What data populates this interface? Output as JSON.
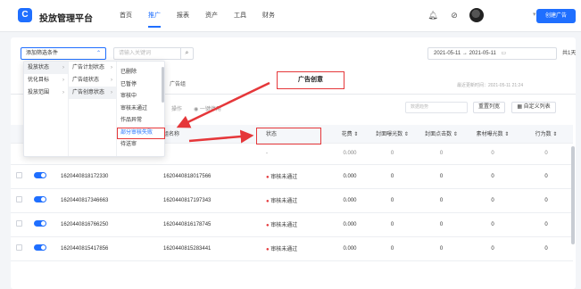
{
  "app": {
    "logo_text": "C",
    "title": "投放管理平台"
  },
  "nav": [
    "首页",
    "推广",
    "报表",
    "资产",
    "工具",
    "财务"
  ],
  "header": {
    "user_caret": "▾",
    "create_button": "创建广告"
  },
  "filters": {
    "add_filter": "添加筛选条件",
    "search_placeholder": "请输入关键词",
    "date_range": "2021-05-11  →  2021-05-11",
    "days": "共1天"
  },
  "dropdown": {
    "col1": [
      "投放状态",
      "优化目标",
      "投放范围"
    ],
    "col2": [
      "广告计划状态",
      "广告组状态",
      "广告创意状态"
    ],
    "col3": [
      "已删除",
      "已暂停",
      "审核中",
      "审核未通过",
      "作品异常",
      "部分审核失败",
      "待送审"
    ]
  },
  "tabs": {
    "adgroup": "广告组",
    "creative": "广告创意"
  },
  "update_time": "最近更新时间：2021-05-11 21:24",
  "toolbar": {
    "batch_select": "操作",
    "batch_label": "◉ 一键停用",
    "data_select": "数据趋势",
    "reset_button": "重置列宽",
    "custom_button": "▦ 自定义列表"
  },
  "table": {
    "headers": [
      "",
      "",
      "",
      "组名称",
      "状态",
      "花费 ⇕",
      "封面曝光数 ⇕",
      "封面点击数 ⇕",
      "素材曝光数 ⇕",
      "行为数 ⇕"
    ],
    "summary": {
      "name": "-",
      "status": "-",
      "spend": "0.000",
      "c1": "0",
      "c2": "0",
      "c3": "0",
      "c4": "0"
    },
    "rows": [
      {
        "id": "1620440818172330",
        "group": "1620440818017566",
        "status": "审核未通过",
        "spend": "0.000",
        "c1": "0",
        "c2": "0",
        "c3": "0",
        "c4": "0"
      },
      {
        "id": "1620440817346663",
        "group": "1620440817197343",
        "status": "审核未通过",
        "spend": "0.000",
        "c1": "0",
        "c2": "0",
        "c3": "0",
        "c4": "0"
      },
      {
        "id": "1620440816766250",
        "group": "1620440816178745",
        "status": "审核未通过",
        "spend": "0.000",
        "c1": "0",
        "c2": "0",
        "c3": "0",
        "c4": "0"
      },
      {
        "id": "1620440815417856",
        "group": "1620440815283441",
        "status": "审核未通过",
        "spend": "0.000",
        "c1": "0",
        "c2": "0",
        "c3": "0",
        "c4": "0"
      }
    ]
  },
  "annotation": {
    "callout": "广告创意"
  },
  "colors": {
    "accent": "#1f6fff",
    "annotation": "#e5373a"
  }
}
